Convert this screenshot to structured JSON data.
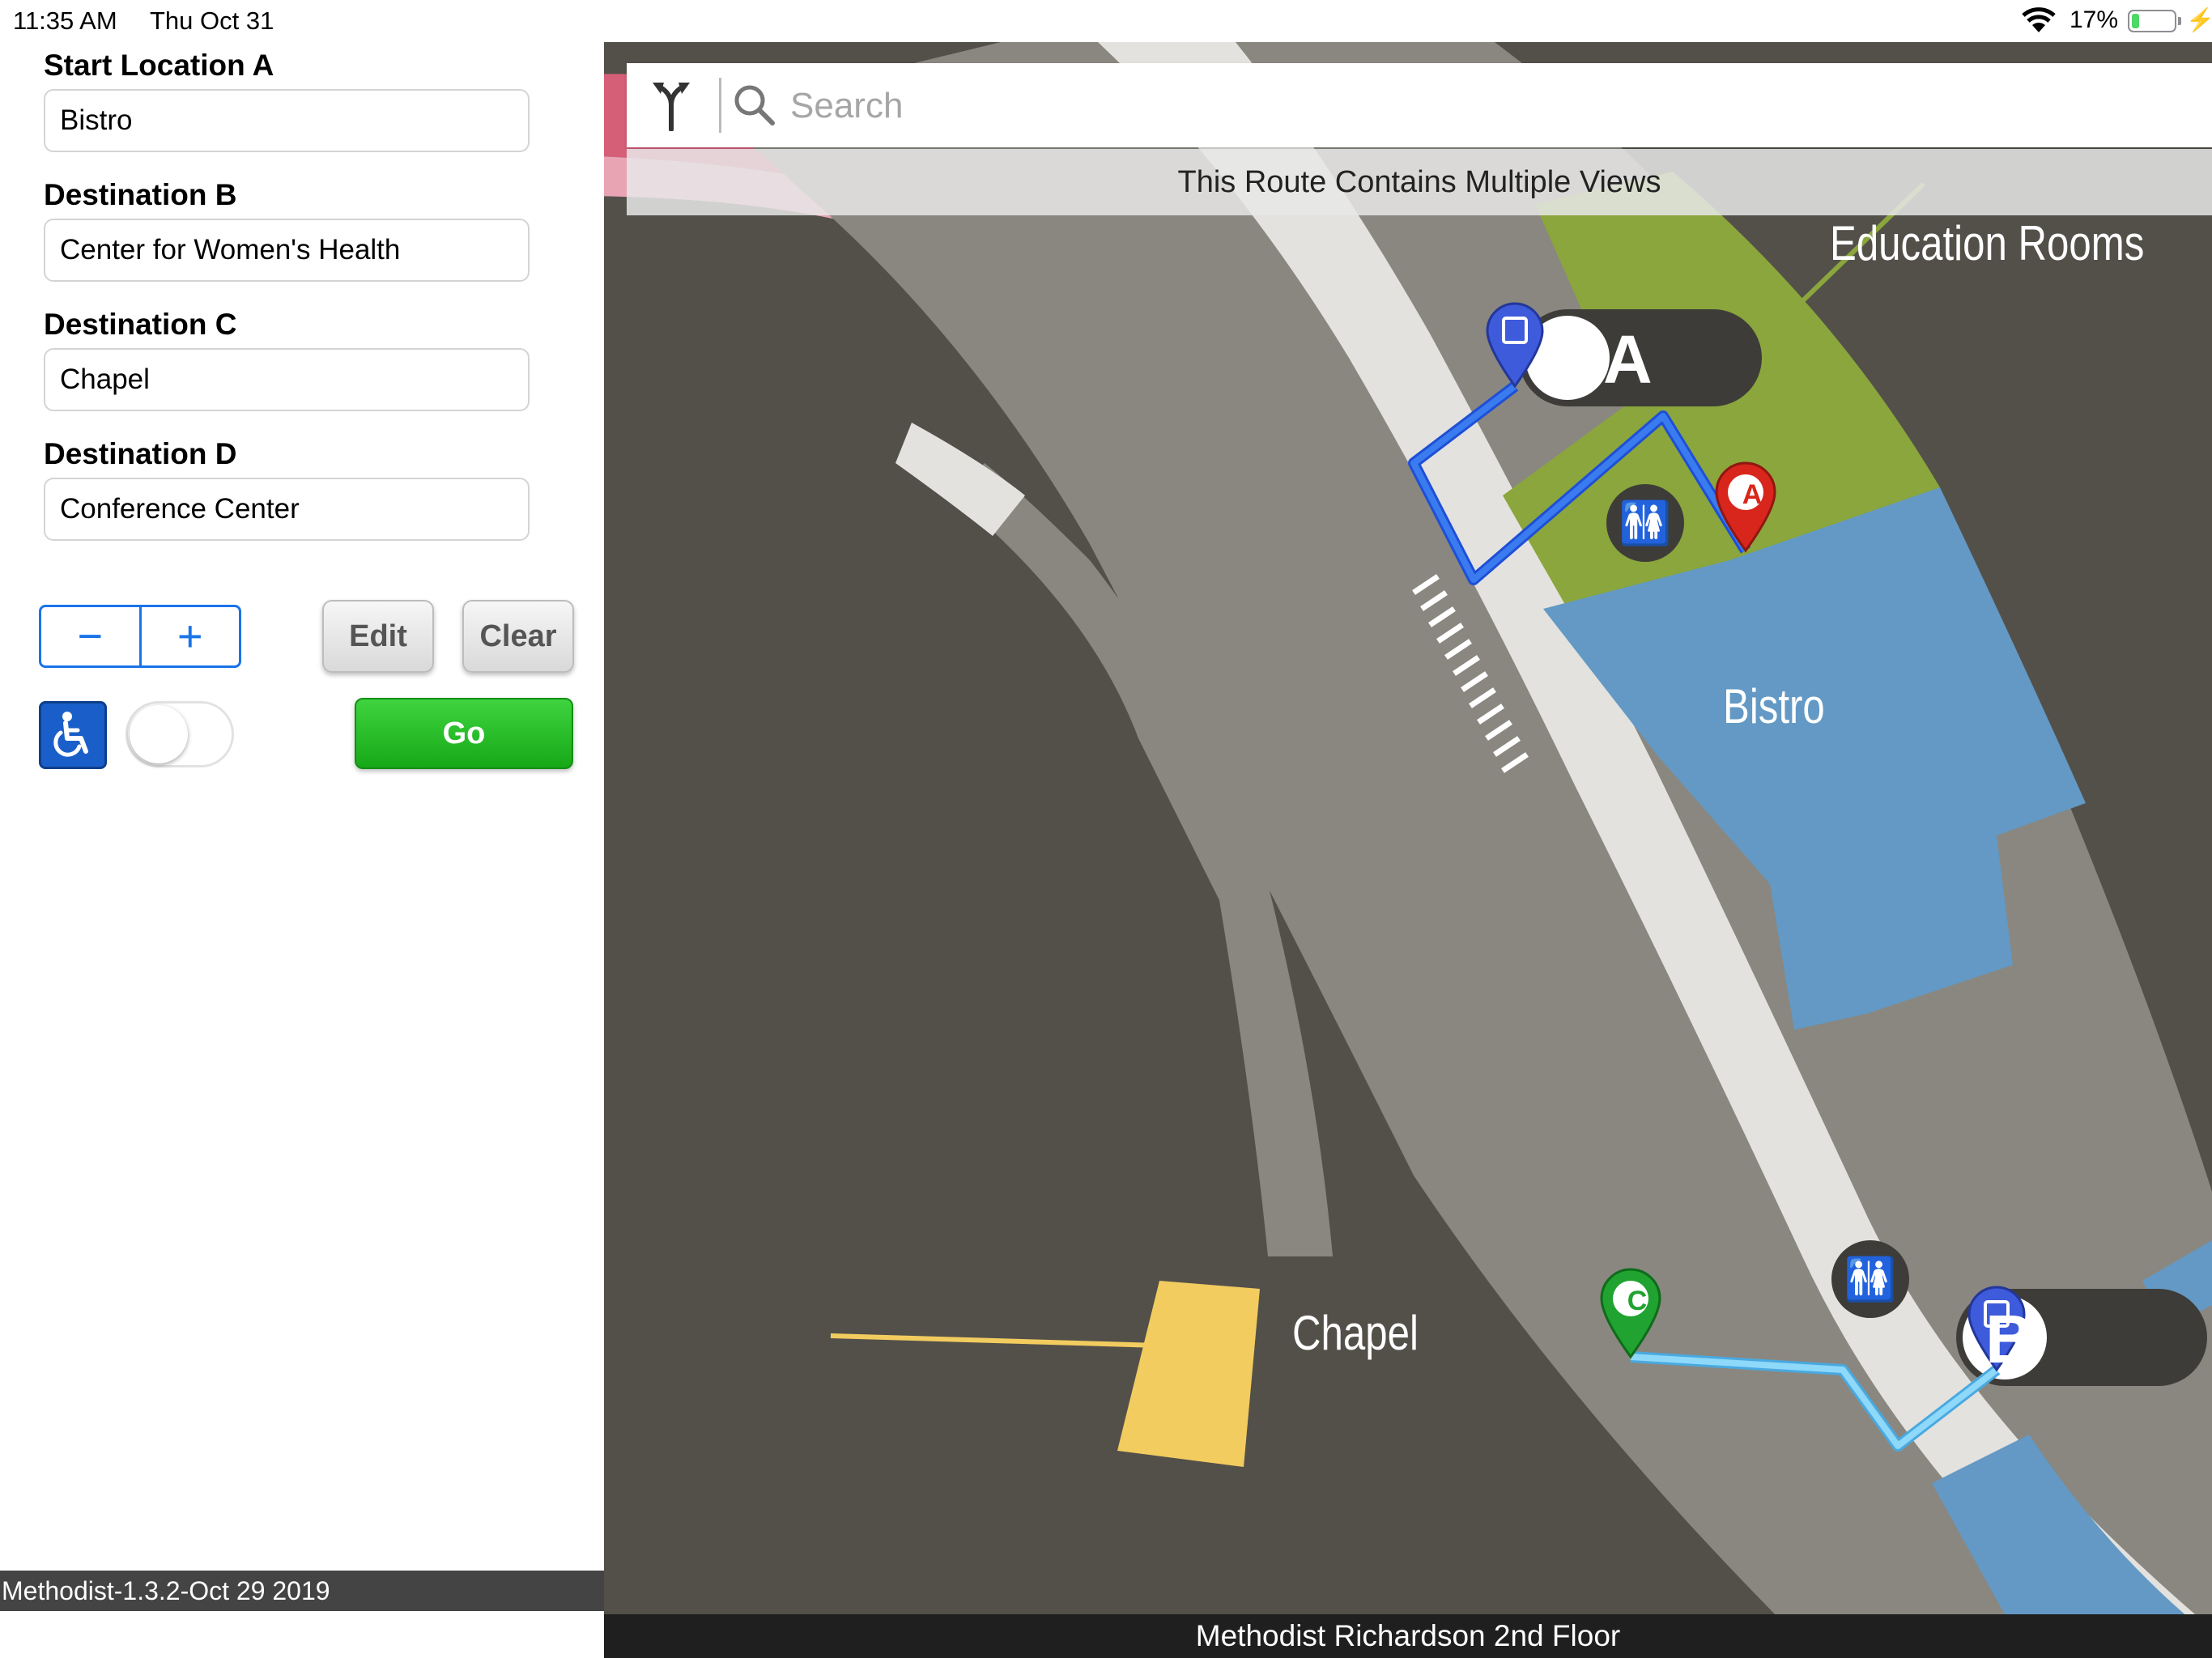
{
  "status_bar": {
    "time": "11:35 AM",
    "date": "Thu Oct 31",
    "battery_percent": "17%",
    "battery_level": 0.17,
    "icons": [
      "wifi-icon",
      "battery-icon",
      "charging-bolt-icon"
    ]
  },
  "form": {
    "start": {
      "label": "Start Location A",
      "value": "Bistro"
    },
    "dest_b": {
      "label": "Destination B",
      "value": "Center for Women's Health"
    },
    "dest_c": {
      "label": "Destination C",
      "value": "Chapel"
    },
    "dest_d": {
      "label": "Destination D",
      "value": "Conference Center"
    }
  },
  "controls": {
    "stepper_minus": "−",
    "stepper_plus": "+",
    "edit_label": "Edit",
    "clear_label": "Clear",
    "go_label": "Go",
    "accessible_toggle_on": false,
    "accessible_icon": "wheelchair-icon"
  },
  "footer": {
    "version": "Methodist-1.3.2-Oct 29 2019"
  },
  "map": {
    "search_placeholder": "Search",
    "route_notice": "This Route Contains Multiple Views",
    "floor_title": "Methodist Richardson 2nd Floor",
    "labels": {
      "education_rooms": "Education Rooms",
      "bistro": "Bistro",
      "chapel": "Chapel"
    },
    "elevator_a": "A",
    "elevator_b": "B",
    "pins": {
      "a": "A",
      "c": "C"
    },
    "colors": {
      "background": "#53504a",
      "corridor": "#8a8780",
      "walkway": "#e3e2df",
      "education": "#8aa63c",
      "bistro": "#6399c4",
      "chapel": "#f2cc5f",
      "pink": "#d65f78",
      "route_blue": "#3a7bf0",
      "route_light": "#6ec6f2",
      "pin_red": "#d9261c",
      "pin_green": "#20a330",
      "pin_blue": "#3d5bdb",
      "go_green": "#22b422",
      "accent": "#1a73e8"
    }
  }
}
